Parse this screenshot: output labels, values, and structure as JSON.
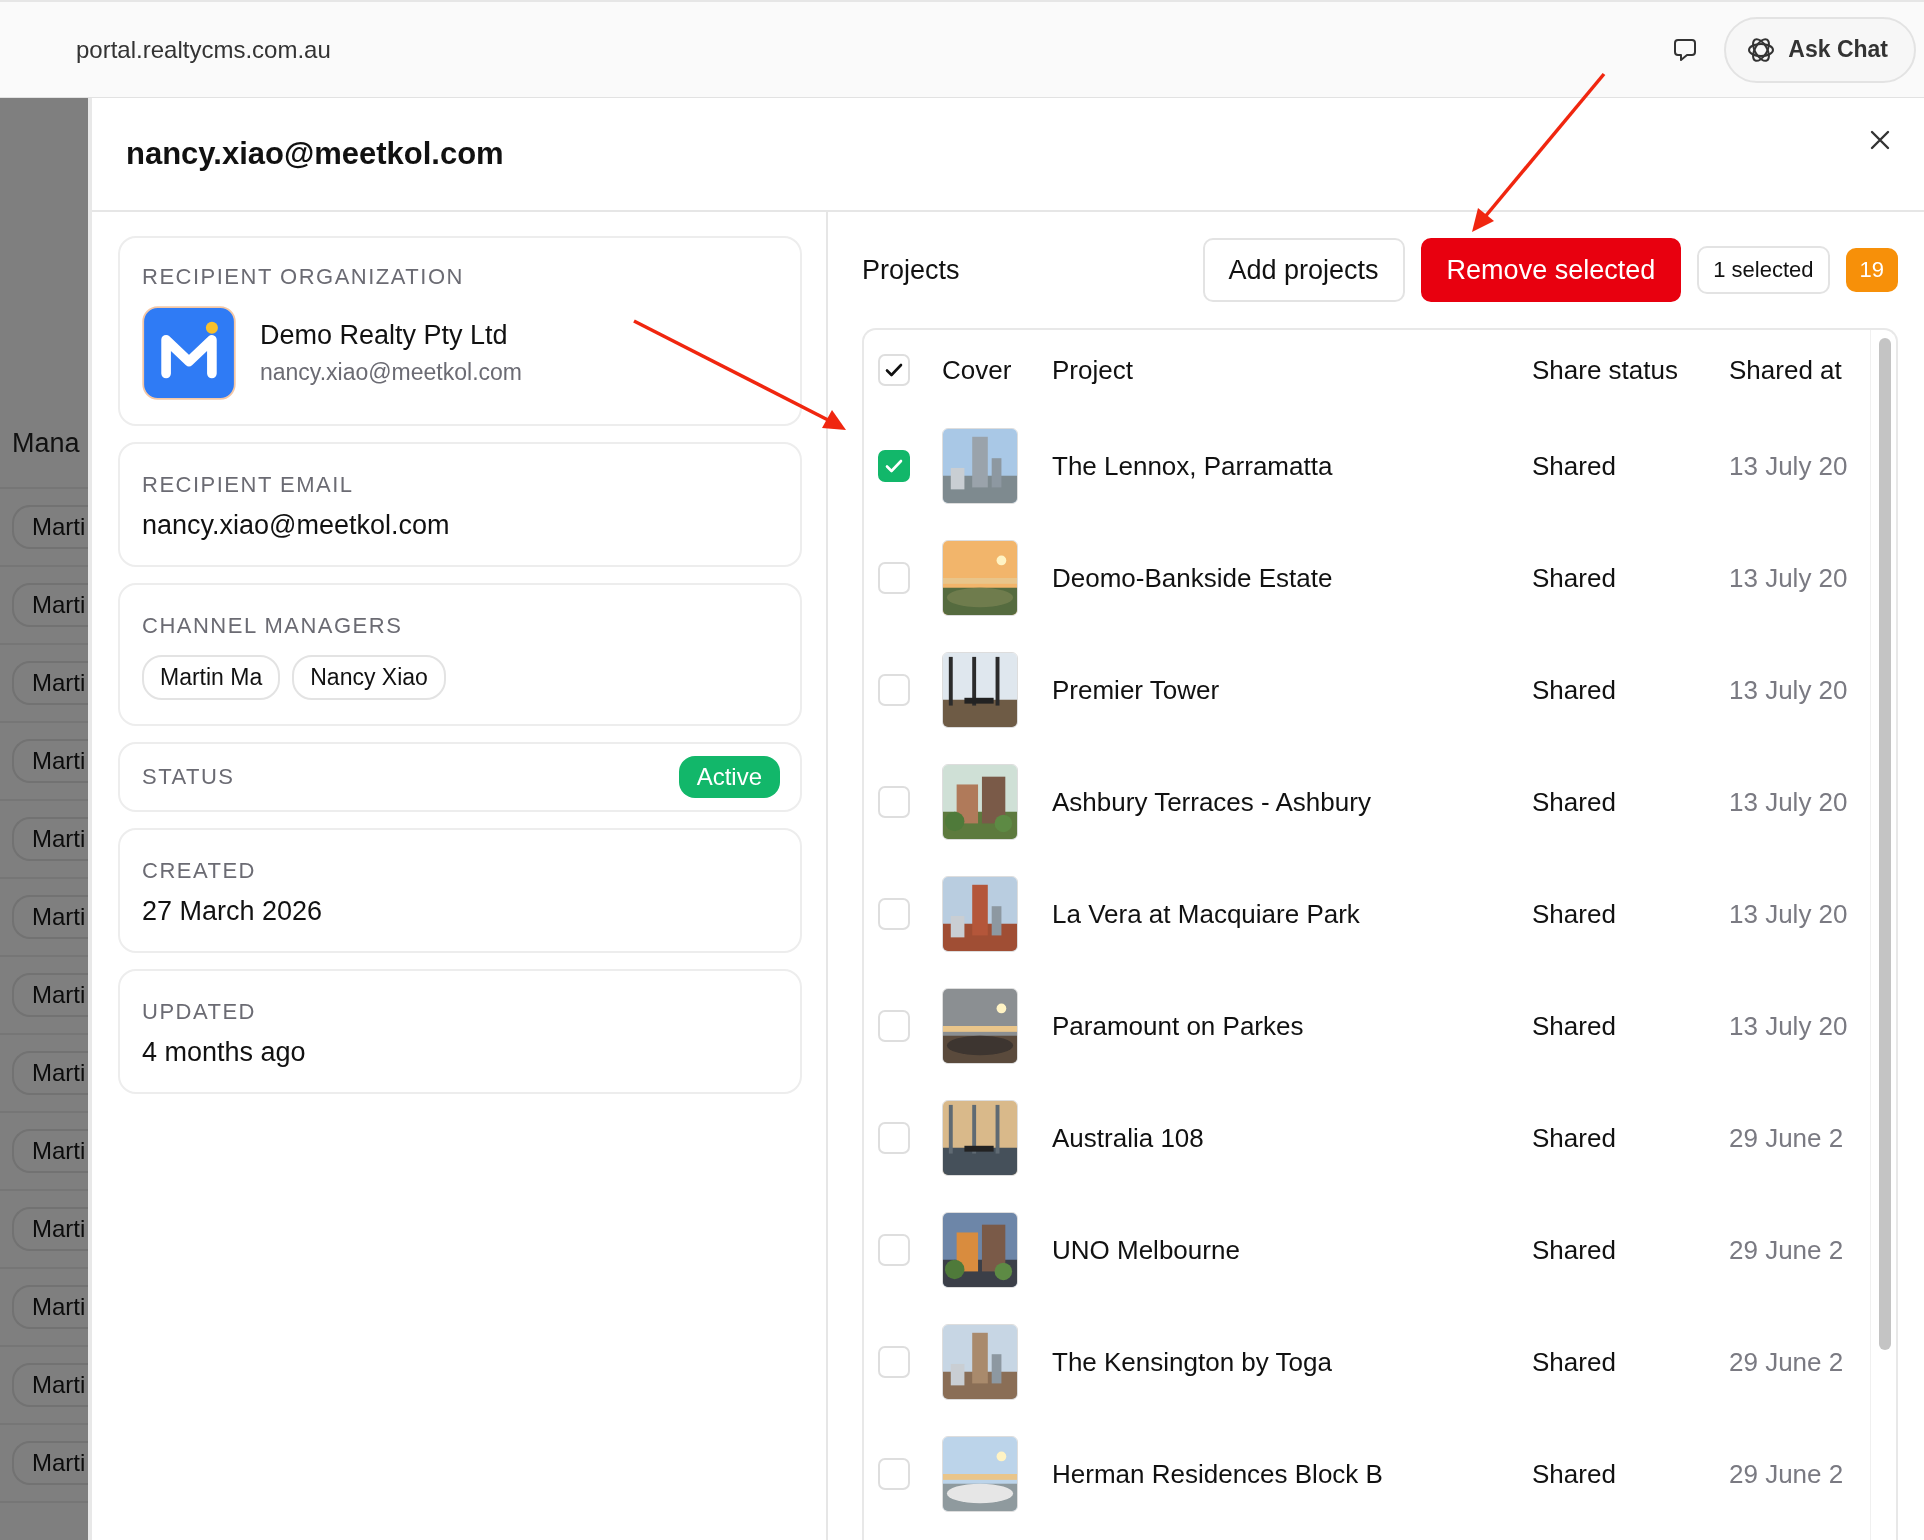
{
  "browser": {
    "url": "portal.realtycms.com.au",
    "ask_chat": "Ask Chat"
  },
  "background_page": {
    "heading": "Mana",
    "rows": [
      "Marti",
      "Marti",
      "Marti",
      "Marti",
      "Marti",
      "Marti",
      "Marti",
      "Marti",
      "Marti",
      "Marti",
      "Marti",
      "Marti",
      "Marti"
    ]
  },
  "drawer": {
    "title": "nancy.xiao@meetkol.com",
    "details": [
      {
        "kind": "organization",
        "label": "RECIPIENT ORGANIZATION",
        "name": "Demo Realty Pty Ltd",
        "email": "nancy.xiao@meetkol.com"
      },
      {
        "kind": "text",
        "label": "RECIPIENT EMAIL",
        "value": "nancy.xiao@meetkol.com"
      },
      {
        "kind": "chips",
        "label": "CHANNEL MANAGERS",
        "chips": [
          "Martin Ma",
          "Nancy Xiao"
        ]
      },
      {
        "kind": "status",
        "label": "STATUS",
        "value": "Active"
      },
      {
        "kind": "text",
        "label": "CREATED",
        "value": "27 March 2026"
      },
      {
        "kind": "text",
        "label": "UPDATED",
        "value": "4 months ago"
      }
    ],
    "projects": {
      "title": "Projects",
      "add_button": "Add projects",
      "remove_button": "Remove selected",
      "selected_count": "1 selected",
      "total": "19",
      "header_checked": true,
      "columns": [
        "Cover",
        "Project",
        "Share status",
        "Shared at"
      ],
      "rows": [
        {
          "selected": true,
          "project": "The Lennox, Parramatta",
          "status": "Shared",
          "shared_at": "13 July 20"
        },
        {
          "selected": false,
          "project": "Deomo-Bankside Estate",
          "status": "Shared",
          "shared_at": "13 July 20"
        },
        {
          "selected": false,
          "project": "Premier Tower",
          "status": "Shared",
          "shared_at": "13 July 20"
        },
        {
          "selected": false,
          "project": "Ashbury Terraces - Ashbury",
          "status": "Shared",
          "shared_at": "13 July 20"
        },
        {
          "selected": false,
          "project": "La Vera at Macquiare Park",
          "status": "Shared",
          "shared_at": "13 July 20"
        },
        {
          "selected": false,
          "project": "Paramount on Parkes",
          "status": "Shared",
          "shared_at": "13 July 20"
        },
        {
          "selected": false,
          "project": "Australia 108",
          "status": "Shared",
          "shared_at": "29 June 2"
        },
        {
          "selected": false,
          "project": "UNO Melbourne",
          "status": "Shared",
          "shared_at": "29 June 2"
        },
        {
          "selected": false,
          "project": "The Kensington by Toga",
          "status": "Shared",
          "shared_at": "29 June 2"
        },
        {
          "selected": false,
          "project": "Herman Residences Block B",
          "status": "Shared",
          "shared_at": "29 June 2"
        }
      ]
    }
  }
}
